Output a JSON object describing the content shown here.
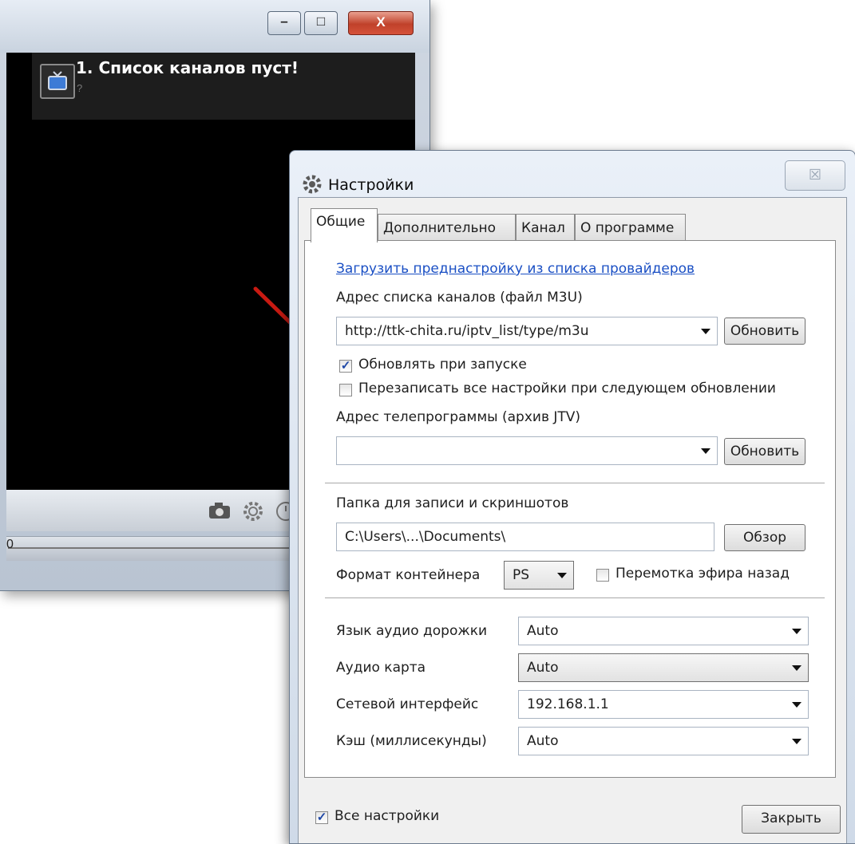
{
  "player": {
    "channel_title": "1. Список каналов пуст!",
    "channel_subtitle": "?",
    "seek_label": "0",
    "minimize_glyph": "–",
    "maximize_glyph": "□",
    "close_glyph": "X"
  },
  "dialog": {
    "title": "Настройки",
    "close_glyph": "☒",
    "tabs": [
      "Общие",
      "Дополнительно",
      "Канал",
      "О программе"
    ],
    "active_tab": "Общие",
    "general": {
      "preset_link": "Загрузить преднастройку из списка провайдеров",
      "channels_label": "Адрес списка каналов (файл M3U)",
      "channels_value": "http://ttk-chita.ru/iptv_list/type/m3u",
      "refresh_button": "Обновить",
      "update_on_start_label": "Обновлять при запуске",
      "update_on_start_checked": true,
      "overwrite_label": "Перезаписать все настройки при следующем обновлении",
      "overwrite_checked": false,
      "epg_label": "Адрес телепрограммы (архив JTV)",
      "epg_value": "",
      "epg_refresh_button": "Обновить",
      "folder_label": "Папка для записи и скриншотов",
      "folder_value": "C:\\Users\\...\\Documents\\",
      "browse_button": "Обзор",
      "container_label": "Формат контейнера",
      "container_value": "PS",
      "timeshift_label": "Перемотка эфира назад",
      "timeshift_checked": false,
      "audio_lang_label": "Язык аудио дорожки",
      "audio_lang_value": "Auto",
      "audio_card_label": "Аудио карта",
      "audio_card_value": "Auto",
      "net_iface_label": "Сетевой интерфейс",
      "net_iface_value": "192.168.1.1",
      "cache_label": "Кэш (миллисекунды)",
      "cache_value": "Auto"
    },
    "all_settings_label": "Все настройки",
    "all_settings_checked": true,
    "close_button": "Закрыть"
  },
  "colors": {
    "annotation_arrow": "#c81a12",
    "link": "#1a4fc4",
    "close_button_red": "#c0412a"
  },
  "icons": [
    "tv-icon",
    "camera-icon",
    "gear-icon",
    "clock-icon",
    "settings-gear-icon",
    "dropdown-arrow-icon"
  ]
}
